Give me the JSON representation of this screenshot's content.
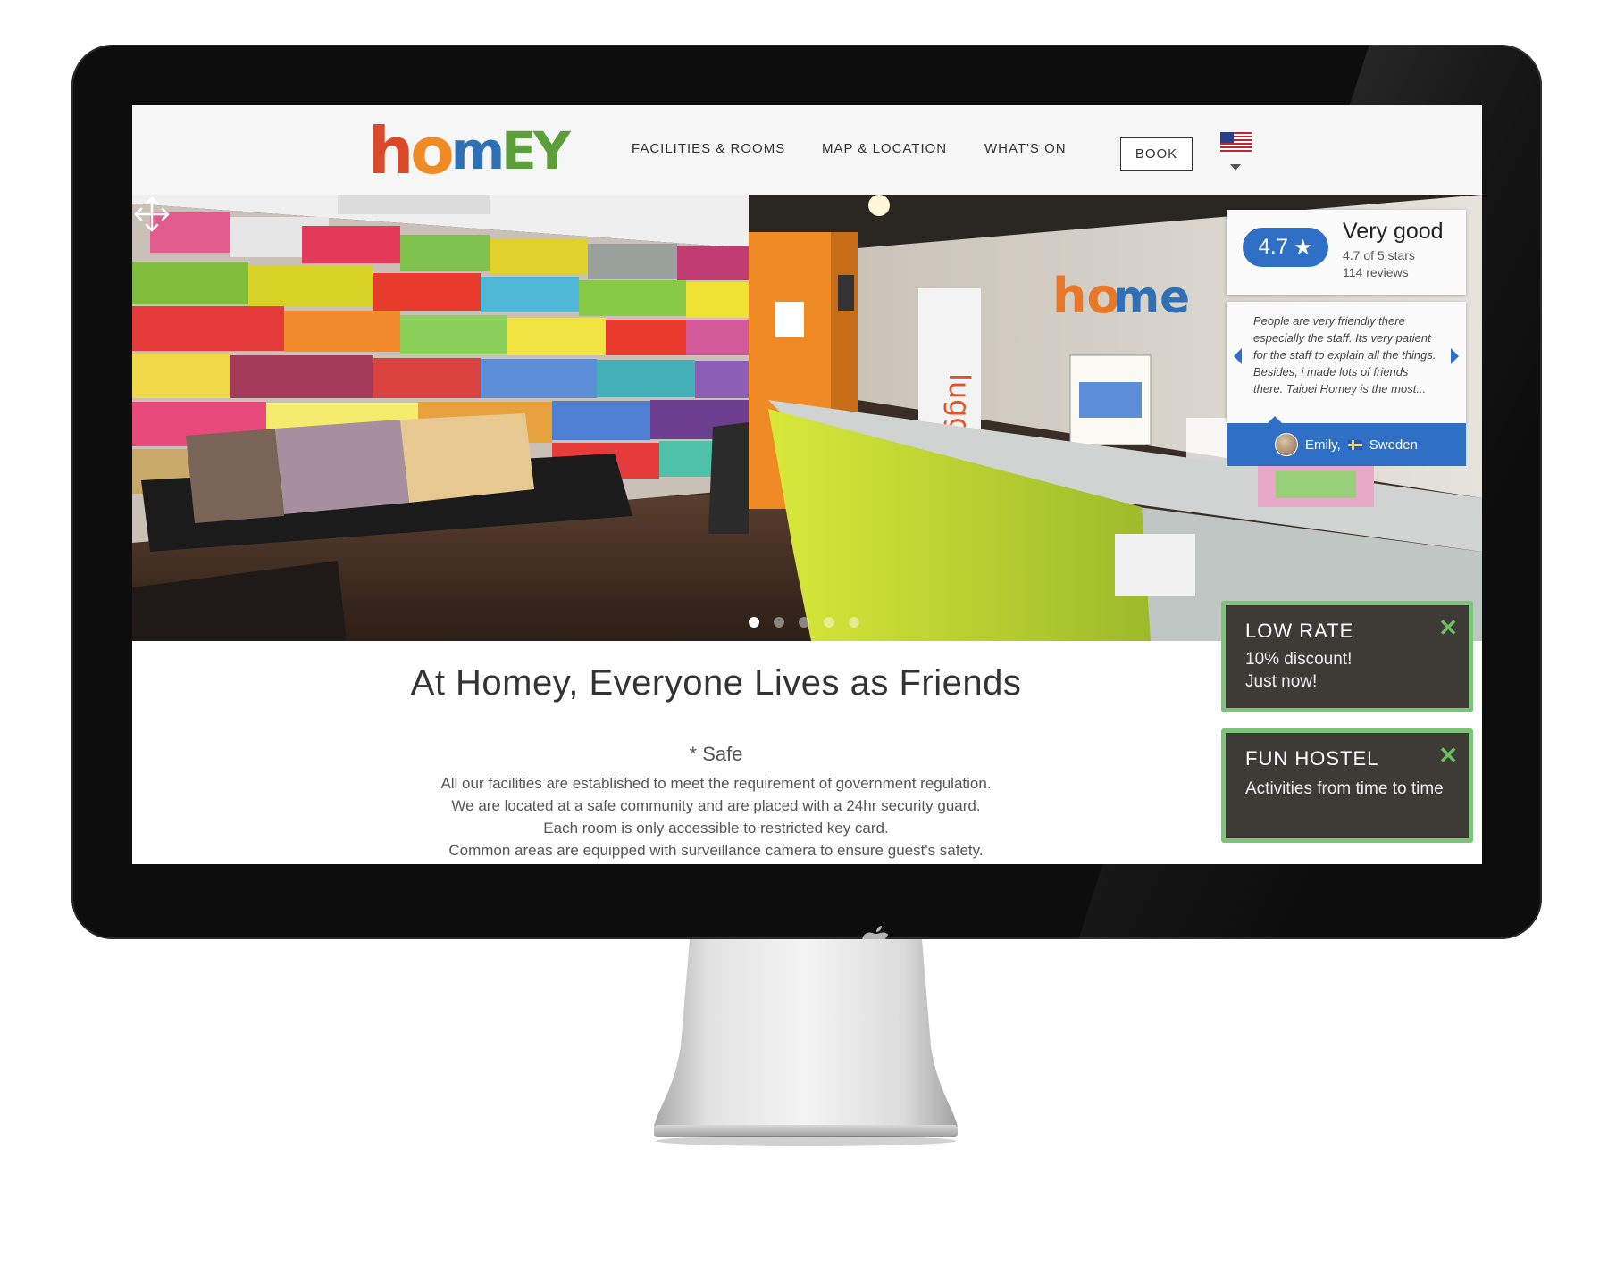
{
  "site": {
    "logo_text": "homey",
    "nav": [
      {
        "label": "FACILITIES & ROOMS"
      },
      {
        "label": "MAP & LOCATION"
      },
      {
        "label": "WHAT'S ON"
      }
    ],
    "book_label": "BOOK",
    "language": "us-flag-icon"
  },
  "hero": {
    "slides_total": 5,
    "active_slide": 1,
    "rating": {
      "score": "4.7",
      "title": "Very good",
      "subtitle": "4.7 of 5 stars",
      "reviews": "114 reviews"
    },
    "review": {
      "text": "People are very friendly there especially the staff. Its very patient for the staff to explain all the things. Besides, i made lots of friends there. Taipei Homey is the most...",
      "author": "Emily,",
      "country": "Sweden"
    }
  },
  "content": {
    "headline": "At Homey, Everyone Lives as Friends",
    "section_title": "* Safe",
    "lines": [
      "All our facilities are established to meet the requirement of government regulation.",
      "We are located at a safe community and are placed with a 24hr security guard.",
      "Each room is only accessible to restricted key card.",
      "Common areas are equipped with surveillance camera to ensure guest's safety."
    ]
  },
  "promos": [
    {
      "title": "LOW RATE",
      "line1": "10% discount!",
      "line2": "Just now!"
    },
    {
      "title": "FUN HOSTEL",
      "body": "Activities from time to time"
    }
  ],
  "colors": {
    "accent_blue": "#2f6fc6",
    "promo_border": "#7cc37a",
    "promo_bg": "#3e3a36"
  }
}
